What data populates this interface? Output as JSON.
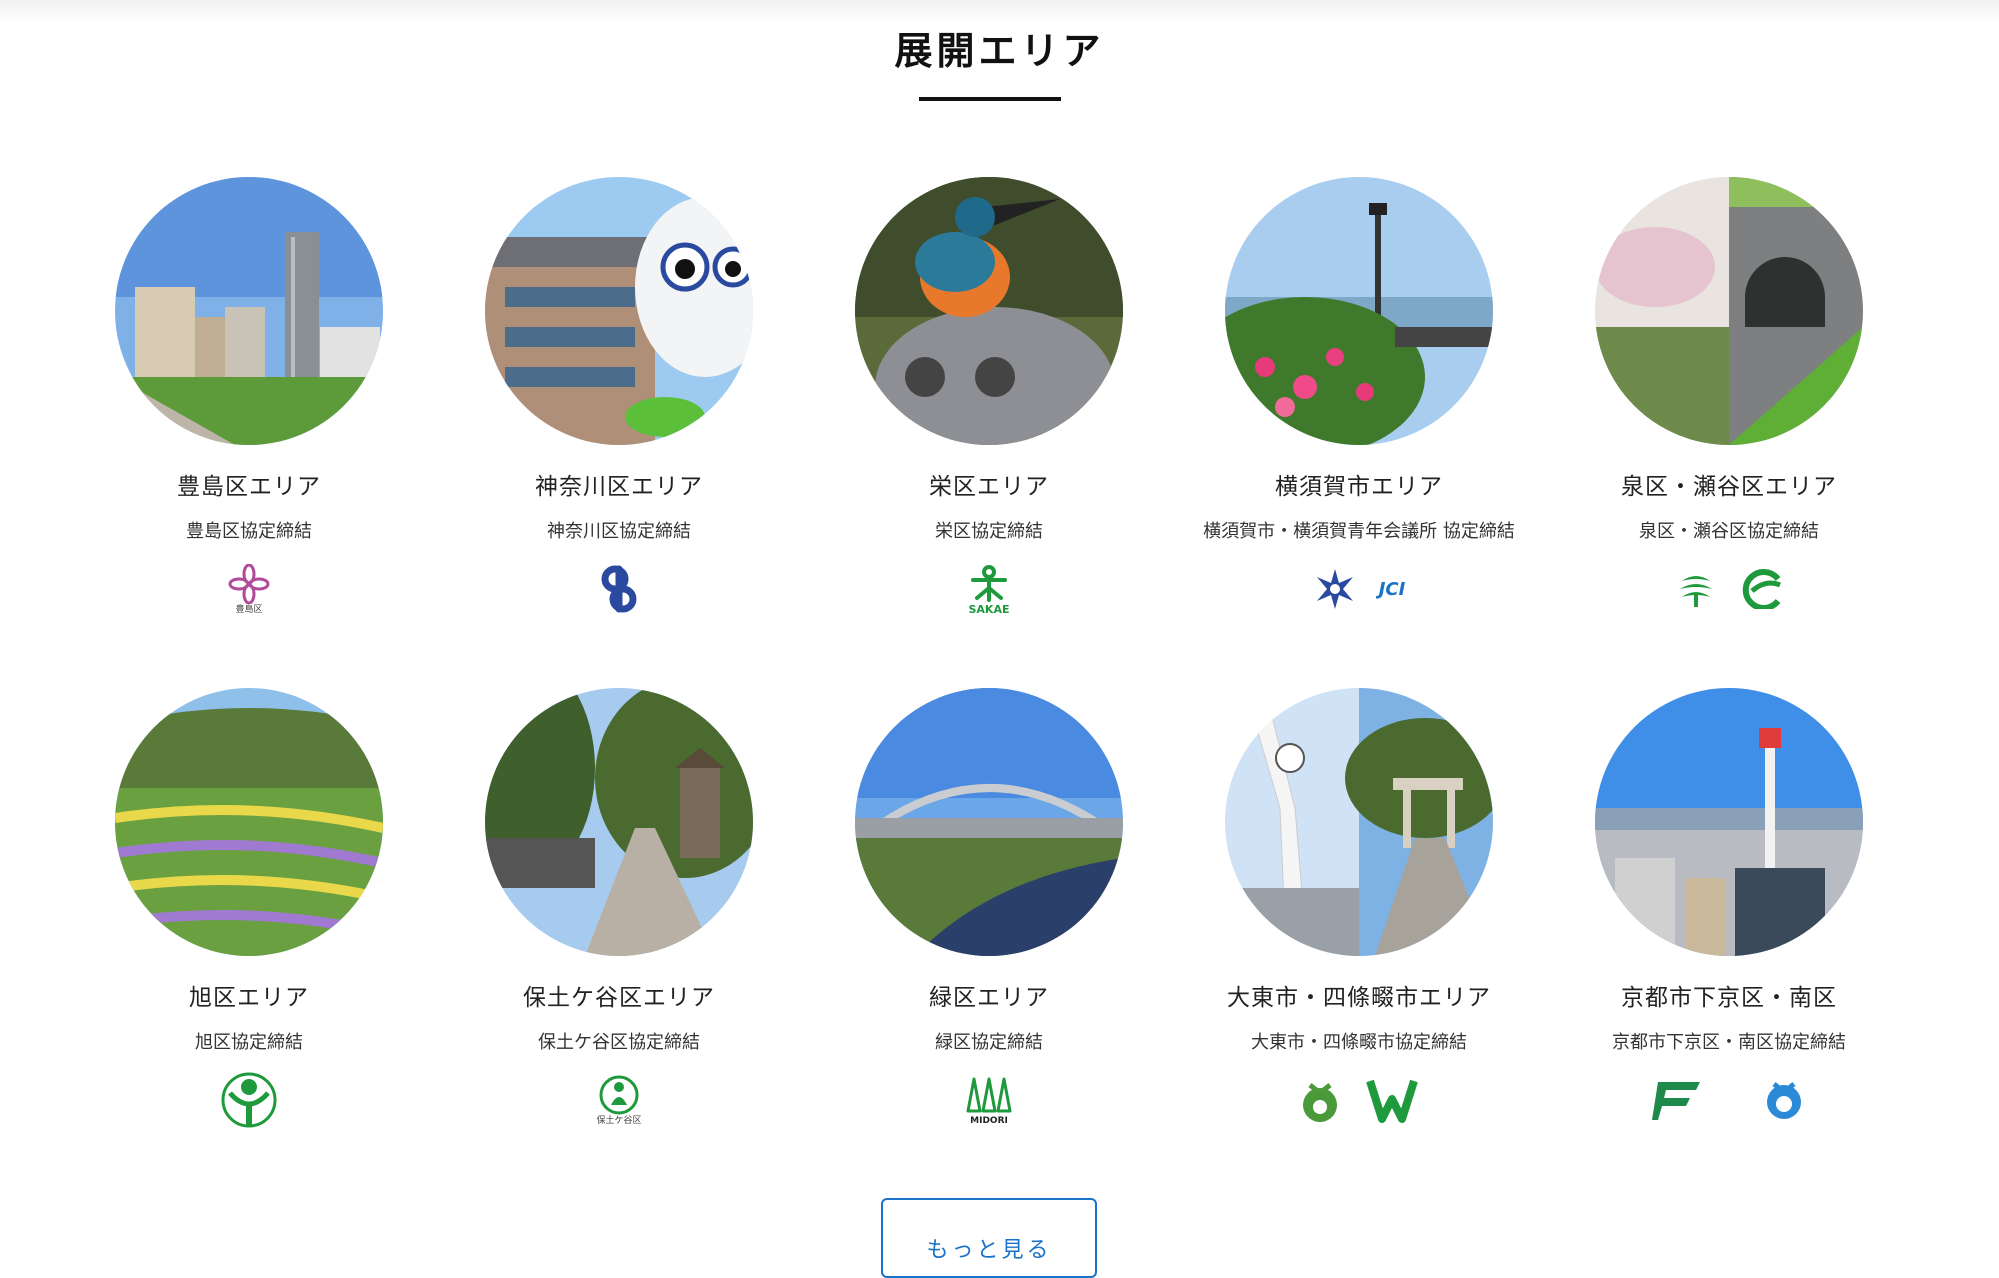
{
  "section": {
    "title": "展開エリア"
  },
  "areas": [
    {
      "name": "豊島区エリア",
      "agreement": "豊島区協定締結",
      "logo_caption": "豊島区"
    },
    {
      "name": "神奈川区エリア",
      "agreement": "神奈川区協定締結"
    },
    {
      "name": "栄区エリア",
      "agreement": "栄区協定締結",
      "logo_caption": "SAKAE"
    },
    {
      "name": "横須賀市エリア",
      "agreement": "横須賀市・横須賀青年会議所 協定締結",
      "logo_caption": "JCI"
    },
    {
      "name": "泉区・瀬谷区エリア",
      "agreement": "泉区・瀬谷区協定締結"
    },
    {
      "name": "旭区エリア",
      "agreement": "旭区協定締結"
    },
    {
      "name": "保土ケ谷区エリア",
      "agreement": "保土ケ谷区協定締結",
      "logo_caption": "保土ケ谷区"
    },
    {
      "name": "緑区エリア",
      "agreement": "緑区協定締結",
      "logo_caption": "MIDORI"
    },
    {
      "name": "大東市・四條畷市エリア",
      "agreement": "大東市・四條畷市協定締結"
    },
    {
      "name": "京都市下京区・南区",
      "agreement": "京都市下京区・南区協定締結"
    }
  ],
  "more_button": {
    "label": "もっと見る"
  },
  "colors": {
    "accent": "#1a73c8",
    "logo_green": "#1e9a3c",
    "logo_blue": "#2a4aa0",
    "logo_pink": "#b04a9a"
  },
  "icons": [
    "photo-area",
    "municipal-logo-icon"
  ]
}
